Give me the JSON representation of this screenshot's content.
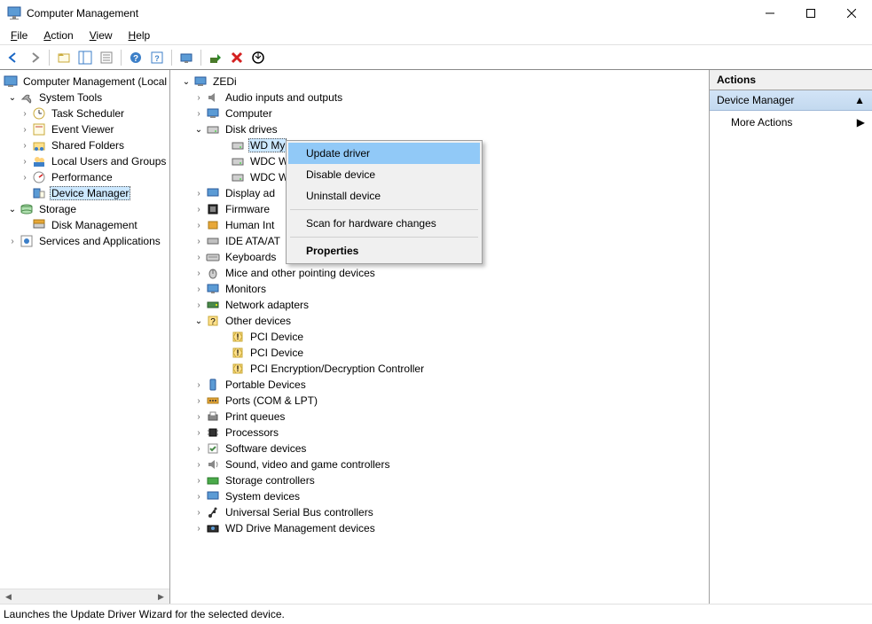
{
  "title": "Computer Management",
  "menu": [
    "File",
    "Action",
    "View",
    "Help"
  ],
  "leftTree": {
    "root": "Computer Management (Local",
    "systemTools": "System Tools",
    "systemToolsChildren": [
      "Task Scheduler",
      "Event Viewer",
      "Shared Folders",
      "Local Users and Groups",
      "Performance",
      "Device Manager"
    ],
    "storage": "Storage",
    "storageChildren": [
      "Disk Management"
    ],
    "services": "Services and Applications"
  },
  "centerTree": {
    "root": "ZEDi",
    "cats": [
      {
        "label": "Audio inputs and outputs",
        "icon": "audio"
      },
      {
        "label": "Computer",
        "icon": "computer"
      },
      {
        "label": "Disk drives",
        "icon": "disk",
        "expanded": true,
        "children": [
          {
            "label": "WD My"
          },
          {
            "label": "WDC W"
          },
          {
            "label": "WDC W"
          }
        ]
      },
      {
        "label": "Display ad",
        "icon": "display"
      },
      {
        "label": "Firmware",
        "icon": "firmware"
      },
      {
        "label": "Human Int",
        "icon": "hid"
      },
      {
        "label": "IDE ATA/AT",
        "icon": "ide"
      },
      {
        "label": "Keyboards",
        "icon": "keyboard"
      },
      {
        "label": "Mice and other pointing devices",
        "icon": "mouse"
      },
      {
        "label": "Monitors",
        "icon": "monitor"
      },
      {
        "label": "Network adapters",
        "icon": "network"
      },
      {
        "label": "Other devices",
        "icon": "other",
        "expanded": true,
        "children": [
          {
            "label": "PCI Device",
            "warn": true
          },
          {
            "label": "PCI Device",
            "warn": true
          },
          {
            "label": "PCI Encryption/Decryption Controller",
            "warn": true
          }
        ]
      },
      {
        "label": "Portable Devices",
        "icon": "portable"
      },
      {
        "label": "Ports (COM & LPT)",
        "icon": "ports"
      },
      {
        "label": "Print queues",
        "icon": "printer"
      },
      {
        "label": "Processors",
        "icon": "cpu"
      },
      {
        "label": "Software devices",
        "icon": "software"
      },
      {
        "label": "Sound, video and game controllers",
        "icon": "sound"
      },
      {
        "label": "Storage controllers",
        "icon": "storage"
      },
      {
        "label": "System devices",
        "icon": "system"
      },
      {
        "label": "Universal Serial Bus controllers",
        "icon": "usb"
      },
      {
        "label": "WD Drive Management devices",
        "icon": "wd"
      }
    ]
  },
  "contextMenu": {
    "items": [
      {
        "label": "Update driver",
        "highlighted": true
      },
      {
        "label": "Disable device"
      },
      {
        "label": "Uninstall device"
      },
      {
        "sep": true
      },
      {
        "label": "Scan for hardware changes"
      },
      {
        "sep": true
      },
      {
        "label": "Properties",
        "bold": true
      }
    ]
  },
  "actionsPanel": {
    "header": "Actions",
    "subheader": "Device Manager",
    "more": "More Actions"
  },
  "statusbar": "Launches the Update Driver Wizard for the selected device."
}
